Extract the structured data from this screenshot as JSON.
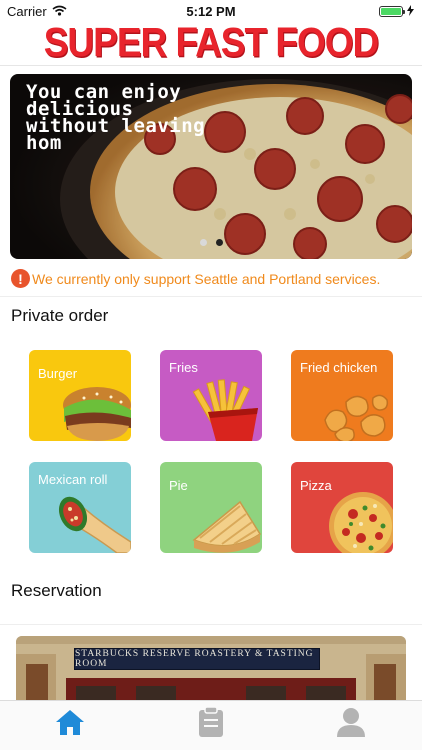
{
  "status_bar": {
    "carrier": "Carrier",
    "time": "5:12 PM"
  },
  "header": {
    "logo_text": "SUPER FAST FOOD"
  },
  "banner": {
    "caption": "You can enjoy delicious without leaving hom",
    "pages": 2,
    "current_page": 1
  },
  "notice": {
    "icon": "alert-circle-icon",
    "text": "We currently only support Seattle and Portland services."
  },
  "private_order": {
    "title": "Private order",
    "items": [
      {
        "label": "Burger",
        "color": "#f9c80e",
        "icon": "burger-icon"
      },
      {
        "label": "Fries",
        "color": "#c65bc4",
        "icon": "fries-icon"
      },
      {
        "label": "Fried chicken",
        "color": "#ef7b1e",
        "icon": "fried-chicken-icon"
      },
      {
        "label": "Mexican roll",
        "color": "#84cfd6",
        "icon": "burrito-icon"
      },
      {
        "label": "Pie",
        "color": "#8fd37f",
        "icon": "pie-icon"
      },
      {
        "label": "Pizza",
        "color": "#e0453d",
        "icon": "pizza-icon"
      }
    ]
  },
  "reservation": {
    "title": "Reservation",
    "sign_text": "STARBUCKS RESERVE  ROASTERY & TASTING ROOM"
  },
  "tabbar": {
    "tabs": [
      {
        "icon": "home-icon",
        "active": true
      },
      {
        "icon": "clipboard-icon",
        "active": false
      },
      {
        "icon": "user-icon",
        "active": false
      }
    ],
    "active_color": "#1f8ad8",
    "inactive_color": "#b3b3b3"
  }
}
